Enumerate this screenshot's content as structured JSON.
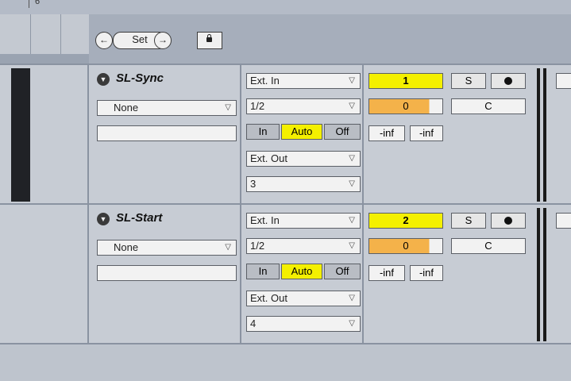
{
  "ruler": {
    "label": "6"
  },
  "set_bar": {
    "prev_icon": "←",
    "set_label": "Set",
    "next_icon": "→"
  },
  "tracks": [
    {
      "name": "SL-Sync",
      "fold_icon": "▼",
      "device_select": "None",
      "input_type": "Ext. In",
      "input_channel": "1/2",
      "monitor_in": "In",
      "monitor_auto": "Auto",
      "monitor_off": "Off",
      "output_type": "Ext. Out",
      "output_channel": "3",
      "track_number": "1",
      "volume": "0",
      "solo": "S",
      "pan": "C",
      "meter_left": "-inf",
      "meter_right": "-inf"
    },
    {
      "name": "SL-Start",
      "fold_icon": "▼",
      "device_select": "None",
      "input_type": "Ext. In",
      "input_channel": "1/2",
      "monitor_in": "In",
      "monitor_auto": "Auto",
      "monitor_off": "Off",
      "output_type": "Ext. Out",
      "output_channel": "4",
      "track_number": "2",
      "volume": "0",
      "solo": "S",
      "pan": "C",
      "meter_left": "-inf",
      "meter_right": "-inf"
    }
  ],
  "colors": {
    "track_number": "#f4f000",
    "volume": "#f4b24a",
    "auto": "#f4f000"
  }
}
